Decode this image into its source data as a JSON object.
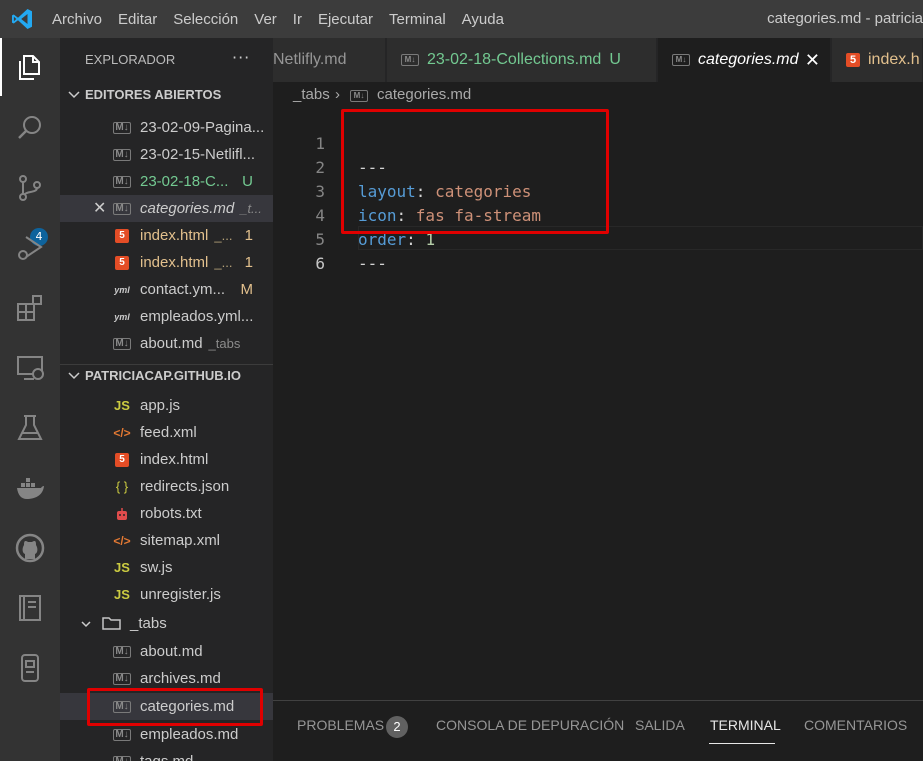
{
  "titlebar": {
    "menu": [
      "Archivo",
      "Editar",
      "Selección",
      "Ver",
      "Ir",
      "Ejecutar",
      "Terminal",
      "Ayuda"
    ],
    "window_title": "categories.md - patricia"
  },
  "activity_bar": {
    "scm_badge": "4",
    "icons": [
      "explorer-icon",
      "search-icon",
      "source-control-icon",
      "run-debug-icon",
      "extensions-icon",
      "remote-explorer-icon",
      "testing-icon",
      "docker-icon",
      "github-icon",
      "notebook-icon",
      "timeline-icon"
    ]
  },
  "sidebar": {
    "title": "EXPLORADOR",
    "more": "···",
    "open_editors": {
      "label": "EDITORES ABIERTOS",
      "items": [
        {
          "name": "23-02-09-Pagina...",
          "icon": "M↓",
          "flag": "",
          "path": ""
        },
        {
          "name": "23-02-15-Netlifl...",
          "icon": "M↓",
          "flag": "",
          "path": ""
        },
        {
          "name": "23-02-18-C...",
          "icon": "M↓",
          "flag": "U",
          "path": ""
        },
        {
          "name": "categories.md",
          "icon": "M↓",
          "flag": "",
          "path": "_t..."
        },
        {
          "name": "index.html",
          "icon": "5",
          "flag": "1",
          "path": "_..."
        },
        {
          "name": "index.html",
          "icon": "5",
          "flag": "1",
          "path": "_..."
        },
        {
          "name": "contact.ym...",
          "icon": "yml",
          "flag": "M",
          "path": ""
        },
        {
          "name": "empleados.yml...",
          "icon": "yml",
          "flag": "",
          "path": ""
        },
        {
          "name": "about.md",
          "icon": "M↓",
          "flag": "",
          "path": "_tabs"
        }
      ]
    },
    "workspace": {
      "label": "PATRICIACAP.GITHUB.IO",
      "items": [
        {
          "name": "app.js",
          "icon": "JS"
        },
        {
          "name": "feed.xml",
          "icon": "</>"
        },
        {
          "name": "index.html",
          "icon": "5"
        },
        {
          "name": "redirects.json",
          "icon": "{ }"
        },
        {
          "name": "robots.txt",
          "icon": "robot"
        },
        {
          "name": "sitemap.xml",
          "icon": "</>"
        },
        {
          "name": "sw.js",
          "icon": "JS"
        },
        {
          "name": "unregister.js",
          "icon": "JS"
        }
      ],
      "folder": "_tabs",
      "folder_items": [
        {
          "name": "about.md",
          "icon": "M↓"
        },
        {
          "name": "archives.md",
          "icon": "M↓"
        },
        {
          "name": "categories.md",
          "icon": "M↓"
        },
        {
          "name": "empleados.md",
          "icon": "M↓"
        },
        {
          "name": "tags.md",
          "icon": "M↓"
        }
      ]
    }
  },
  "tabs": [
    {
      "name": "Netlifly.md",
      "flag": ""
    },
    {
      "name": "23-02-18-Collections.md",
      "flag": "U"
    },
    {
      "name": "categories.md",
      "flag": "",
      "close": "✕"
    },
    {
      "name": "index.h",
      "flag": ""
    }
  ],
  "breadcrumb": {
    "folder": "_tabs",
    "sep": "›",
    "file": "categories.md"
  },
  "editor": {
    "lines": [
      {
        "num": "1",
        "text": "---"
      },
      {
        "num": "2",
        "key": "layout",
        "value": "categories"
      },
      {
        "num": "3",
        "key": "icon",
        "value": "fas fa-stream"
      },
      {
        "num": "4",
        "key": "order",
        "value": "1"
      },
      {
        "num": "5",
        "text": "---"
      },
      {
        "num": "6",
        "text": ""
      }
    ]
  },
  "panel": {
    "tabs": [
      "PROBLEMAS",
      "CONSOLA DE DEPURACIÓN",
      "SALIDA",
      "TERMINAL",
      "COMENTARIOS"
    ],
    "problems_count": "2",
    "active": "TERMINAL"
  },
  "colors": {
    "accent": "#0e639c",
    "highlight": "#e00000",
    "untracked": "#73c991",
    "modified": "#e2c08d"
  }
}
